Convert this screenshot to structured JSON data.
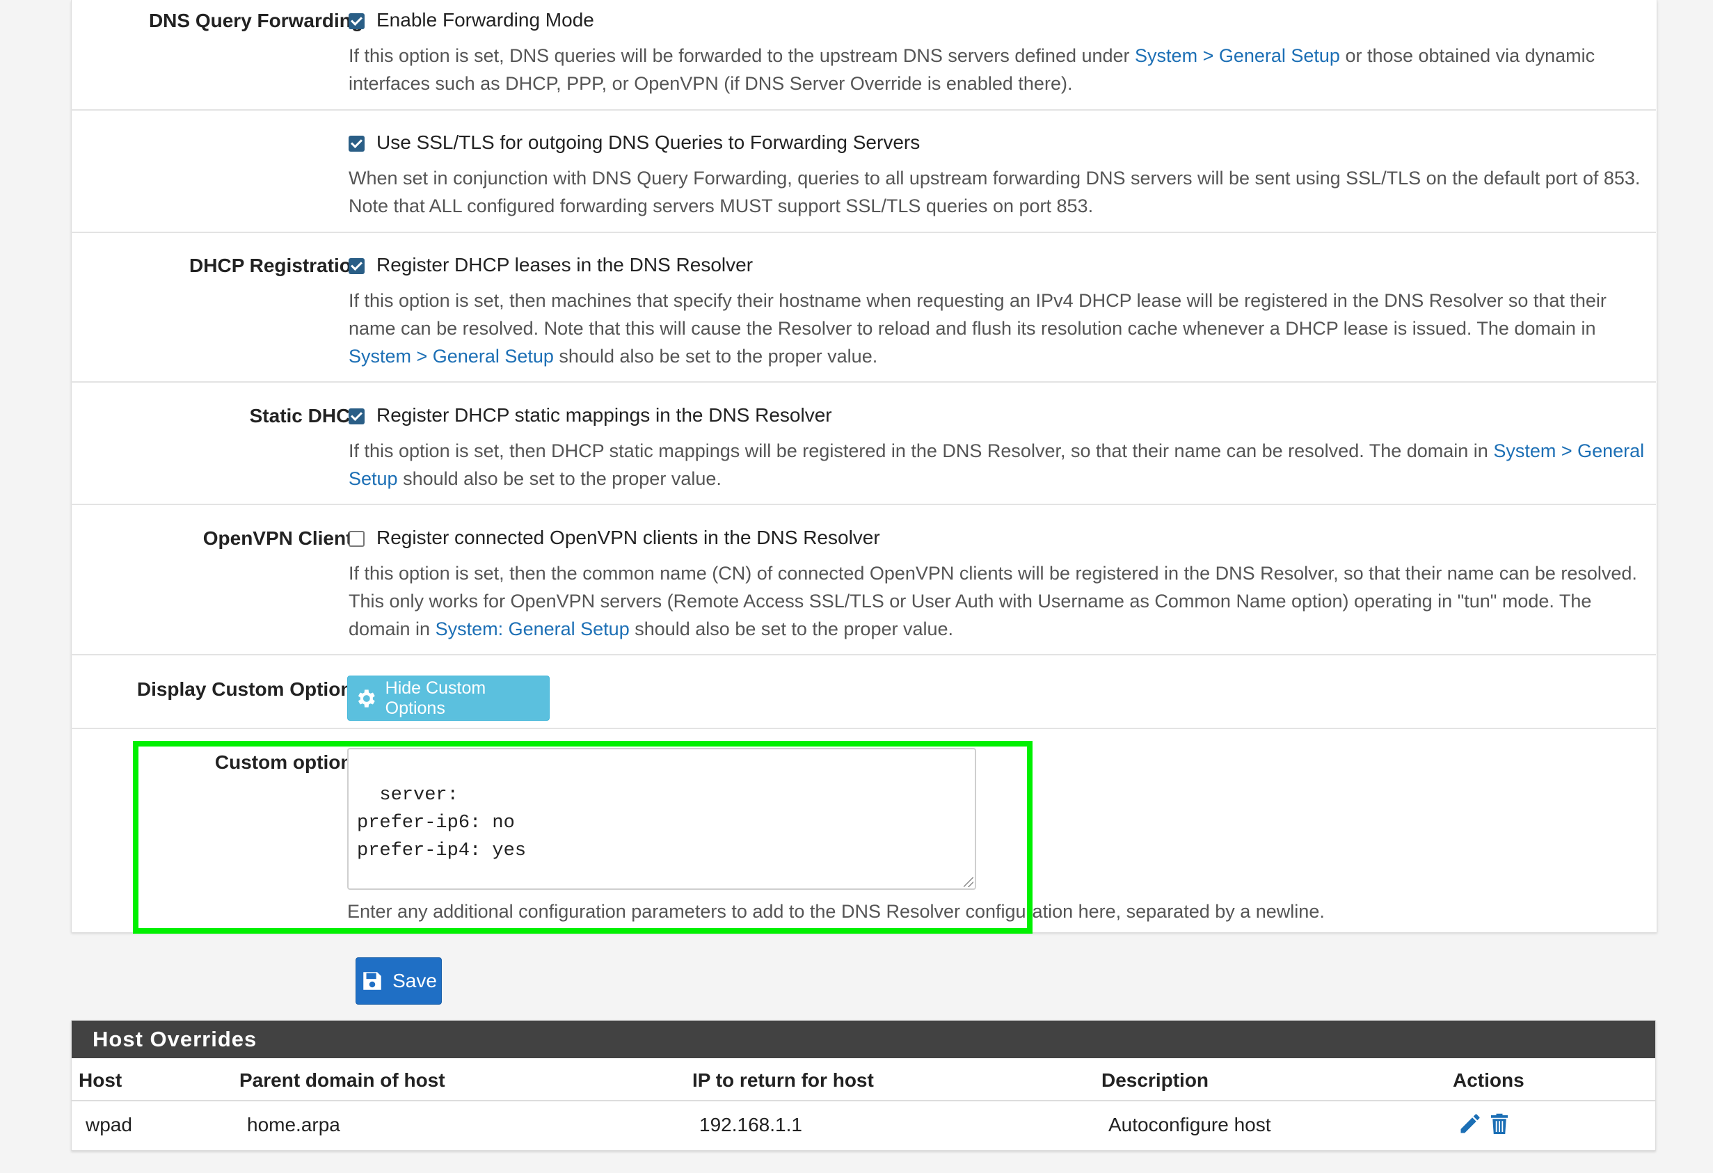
{
  "settings": {
    "forwarding": {
      "label": "DNS Query Forwarding",
      "checkbox_label": "Enable Forwarding Mode",
      "checked": true,
      "help_pre": "If this option is set, DNS queries will be forwarded to the upstream DNS servers defined under ",
      "help_link": "System > General Setup",
      "help_post": " or those obtained via dynamic interfaces such as DHCP, PPP, or OpenVPN (if DNS Server Override is enabled there)."
    },
    "ssl_tls": {
      "checkbox_label": "Use SSL/TLS for outgoing DNS Queries to Forwarding Servers",
      "checked": true,
      "help": "When set in conjunction with DNS Query Forwarding, queries to all upstream forwarding DNS servers will be sent using SSL/TLS on the default port of 853. Note that ALL configured forwarding servers MUST support SSL/TLS queries on port 853."
    },
    "dhcp_registration": {
      "label": "DHCP Registration",
      "checkbox_label": "Register DHCP leases in the DNS Resolver",
      "checked": true,
      "help_pre": "If this option is set, then machines that specify their hostname when requesting an IPv4 DHCP lease will be registered in the DNS Resolver so that their name can be resolved. Note that this will cause the Resolver to reload and flush its resolution cache whenever a DHCP lease is issued. The domain in ",
      "help_link": "System > General Setup",
      "help_post": " should also be set to the proper value."
    },
    "static_dhcp": {
      "label": "Static DHCP",
      "checkbox_label": "Register DHCP static mappings in the DNS Resolver",
      "checked": true,
      "help_pre": "If this option is set, then DHCP static mappings will be registered in the DNS Resolver, so that their name can be resolved. The domain in ",
      "help_link": "System > General Setup",
      "help_post": " should also be set to the proper value."
    },
    "openvpn_clients": {
      "label": "OpenVPN Clients",
      "checkbox_label": "Register connected OpenVPN clients in the DNS Resolver",
      "checked": false,
      "help_pre": "If this option is set, then the common name (CN) of connected OpenVPN clients will be registered in the DNS Resolver, so that their name can be resolved. This only works for OpenVPN servers (Remote Access SSL/TLS or User Auth with Username as Common Name option) operating in \"tun\" mode. The domain in ",
      "help_link": "System: General Setup",
      "help_post": " should also be set to the proper value."
    },
    "display_custom": {
      "label": "Display Custom Options",
      "button_label": "Hide Custom Options",
      "button_icon": "gear-icon"
    },
    "custom_options": {
      "label": "Custom options",
      "value": "server:\nprefer-ip6: no\nprefer-ip4: yes",
      "help": "Enter any additional configuration parameters to add to the DNS Resolver configuration here, separated by a newline."
    }
  },
  "save_button": {
    "label": "Save",
    "icon": "floppy-disk-icon"
  },
  "host_overrides": {
    "title": "Host Overrides",
    "columns": [
      "Host",
      "Parent domain of host",
      "IP to return for host",
      "Description",
      "Actions"
    ],
    "rows": [
      {
        "host": "wpad",
        "domain": "home.arpa",
        "ip": "192.168.1.1",
        "description": "Autoconfigure host",
        "actions": [
          "pencil-icon",
          "trash-icon"
        ]
      }
    ]
  },
  "colors": {
    "link": "#1c6fb5",
    "checkbox_checked": "#2a5e86",
    "info_button": "#5bc0de",
    "primary_button": "#1f6fc5",
    "highlight": "#00f000",
    "table_header_bg": "#424242"
  }
}
